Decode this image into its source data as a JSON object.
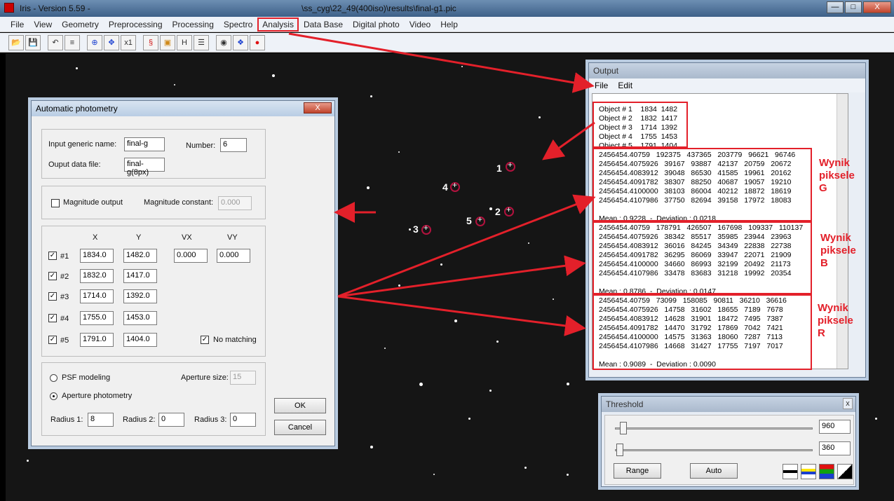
{
  "window": {
    "title": "Iris - Version 5.59 -",
    "path": "\\ss_cyg\\22_49(400iso)\\results\\final-g1.pic",
    "buttons": {
      "minimize": "—",
      "maximize": "□",
      "close": "X"
    }
  },
  "menu": [
    "File",
    "View",
    "Geometry",
    "Preprocessing",
    "Processing",
    "Spectro",
    "Analysis",
    "Data Base",
    "Digital photo",
    "Video",
    "Help"
  ],
  "toolbar": [
    "open",
    "save",
    "undo",
    "settings",
    "crosshair",
    "move",
    "x1",
    "s",
    "box",
    "H",
    "list",
    "camera",
    "diamond",
    "record"
  ],
  "toolbar_text": {
    "x1": "x1",
    "H": "H"
  },
  "markers": [
    {
      "label": "1"
    },
    {
      "label": "2"
    },
    {
      "label": "3"
    },
    {
      "label": "4"
    },
    {
      "label": "5"
    }
  ],
  "photometry": {
    "title": "Automatic photometry",
    "close": "X",
    "input_generic_label": "Input generic name:",
    "input_generic_value": "final-g",
    "number_label": "Number:",
    "number_value": "6",
    "output_label": "Ouput data file:",
    "output_value": "final-g(8px)",
    "magnitude_output": "Magnitude output",
    "magnitude_constant_label": "Magnitude constant:",
    "magnitude_constant_value": "0.000",
    "col_x": "X",
    "col_y": "Y",
    "col_vx": "VX",
    "col_vy": "VY",
    "rows": [
      {
        "id": "#1",
        "x": "1834.0",
        "y": "1482.0",
        "vx": "0.000",
        "vy": "0.000"
      },
      {
        "id": "#2",
        "x": "1832.0",
        "y": "1417.0"
      },
      {
        "id": "#3",
        "x": "1714.0",
        "y": "1392.0"
      },
      {
        "id": "#4",
        "x": "1755.0",
        "y": "1453.0"
      },
      {
        "id": "#5",
        "x": "1791.0",
        "y": "1404.0"
      }
    ],
    "no_matching": "No matching",
    "psf": "PSF modeling",
    "aperture_size_label": "Aperture size:",
    "aperture_size_value": "15",
    "aperture": "Aperture photometry",
    "radius1_label": "Radius 1:",
    "radius1_value": "8",
    "radius2_label": "Radius 2:",
    "radius2_value": "0",
    "radius3_label": "Radius 3:",
    "radius3_value": "0",
    "ok": "OK",
    "cancel": "Cancel"
  },
  "output": {
    "title": "Output",
    "menu": [
      "File",
      "Edit"
    ],
    "objects": [
      "Object # 1    1834  1482",
      "Object # 2    1832  1417",
      "Object # 3    1714  1392",
      "Object # 4    1755  1453",
      "Object # 5    1791  1404"
    ],
    "g_lines": [
      "2456454.40759   192375   437365   203779   96621   96746",
      "2456454.4075926   39167   93887   42137   20759   20672",
      "2456454.4083912   39048   86530   41585   19961   20162",
      "2456454.4091782   38307   88250   40687   19057   19210",
      "2456454.4100000   38103   86004   40212   18872   18619",
      "2456454.4107986   37750   82694   39158   17972   18083"
    ],
    "g_mean": "Mean : 0.9228  -  Deviation : 0.0218",
    "b_lines": [
      "2456454.40759   178791   426507   167698   109337   110137",
      "2456454.4075926   38342   85517   35985   23944   23963",
      "2456454.4083912   36016   84245   34349   22838   22738",
      "2456454.4091782   36295   86069   33947   22071   21909",
      "2456454.4100000   34660   86993   32199   20492   21173",
      "2456454.4107986   33478   83683   31218   19992   20354"
    ],
    "b_mean": "Mean : 0.8786  -  Deviation : 0.0147",
    "r_lines": [
      "2456454.40759   73099   158085   90811   36210   36616",
      "2456454.4075926   14758   31602   18655   7189   7678",
      "2456454.4083912   14628   31901   18472   7495   7387",
      "2456454.4091782   14470   31792   17869   7042   7421",
      "2456454.4100000   14575   31363   18060   7287   7113",
      "2456454.4107986   14668   31427   17755   7197   7017"
    ],
    "r_mean": "Mean : 0.9089  -  Deviation : 0.0090"
  },
  "annotations": {
    "g": [
      "Wynik",
      "piksele",
      "G"
    ],
    "b": [
      "Wynik",
      "piksele",
      "B"
    ],
    "r": [
      "Wynik",
      "piksele",
      "R"
    ],
    "color": "#e3202a"
  },
  "threshold": {
    "title": "Threshold",
    "close": "x",
    "high": "960",
    "low": "360",
    "range": "Range",
    "auto": "Auto"
  }
}
